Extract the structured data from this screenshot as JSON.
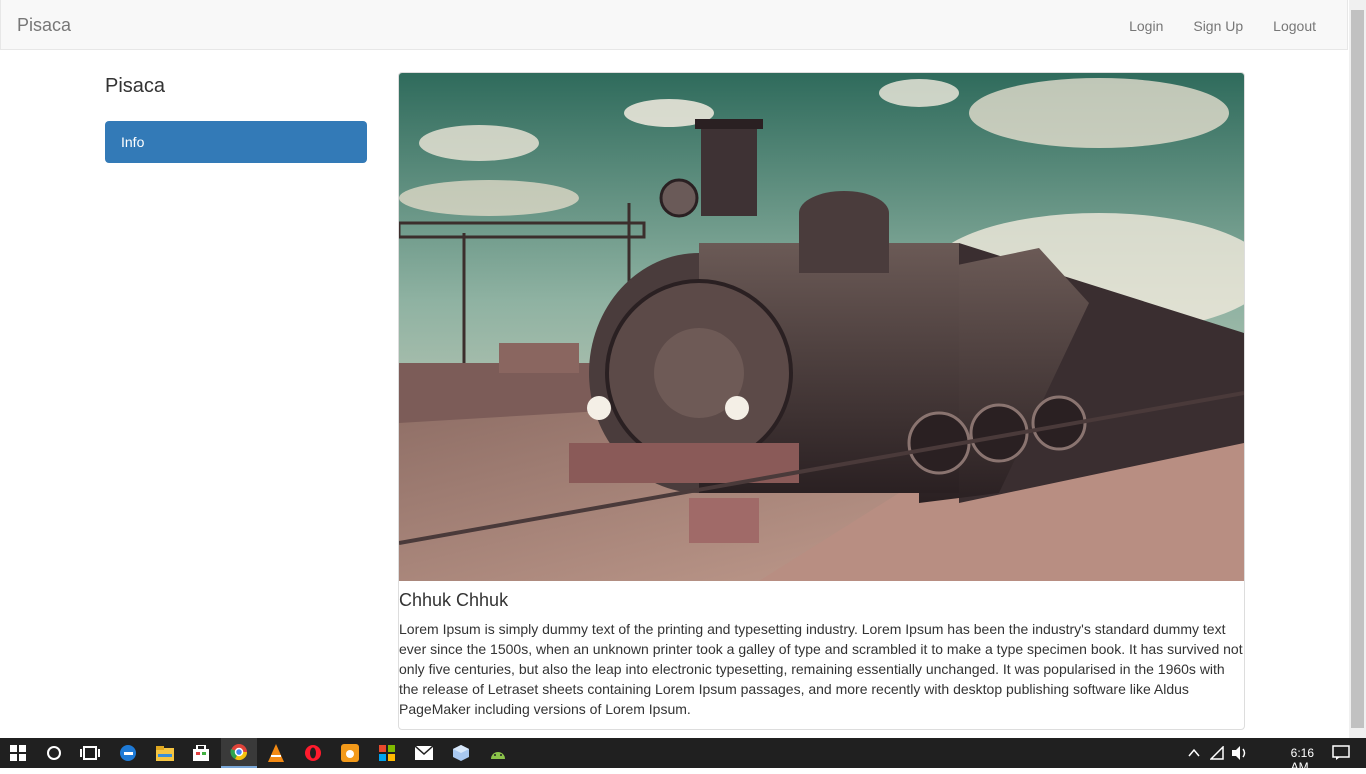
{
  "navbar": {
    "brand": "Pisaca",
    "links": [
      "Login",
      "Sign Up",
      "Logout"
    ]
  },
  "sidebar": {
    "title": "Pisaca",
    "items": [
      {
        "label": "Info"
      }
    ]
  },
  "post": {
    "title": "Chhuk Chhuk",
    "body": "Lorem Ipsum is simply dummy text of the printing and typesetting industry. Lorem Ipsum has been the industry's standard dummy text ever since the 1500s, when an unknown printer took a galley of type and scrambled it to make a type specimen book. It has survived not only five centuries, but also the leap into electronic typesetting, remaining essentially unchanged. It was popularised in the 1960s with the release of Letraset sheets containing Lorem Ipsum passages, and more recently with desktop publishing software like Aldus PageMaker including versions of Lorem Ipsum."
  },
  "taskbar": {
    "icons": [
      "windows-start-icon",
      "search-icon",
      "task-view-icon",
      "edge-icon",
      "file-explorer-icon",
      "store-icon",
      "chrome-icon",
      "vlc-icon",
      "opera-icon",
      "uc-browser-icon",
      "office-icon",
      "mail-icon",
      "app-box-icon",
      "android-icon"
    ],
    "time": "6:16 AM"
  },
  "colors": {
    "accent": "#337ab7",
    "navbar_bg": "#f8f8f8",
    "taskbar_bg": "#202020"
  }
}
